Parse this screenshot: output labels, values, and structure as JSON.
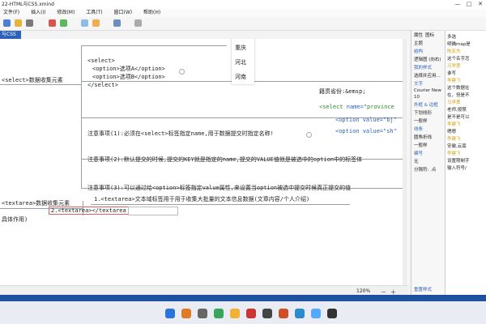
{
  "window": {
    "title": "22-HTML与CSS.xmind",
    "controls": [
      "—",
      "□",
      "✕"
    ]
  },
  "menu": {
    "items": [
      "文件(F)",
      "插入(I)",
      "修改(M)",
      "工具(T)",
      "窗口(W)",
      "帮助(H)"
    ]
  },
  "doc_tab": {
    "label": "与CSS"
  },
  "map": {
    "select_node": {
      "label": "<select>数据收集元素"
    },
    "select_code": {
      "lines": [
        "<select>",
        "  <option>选项A</option>",
        "  <option>选项B</option>",
        "</select>"
      ]
    },
    "dropdown": {
      "options": [
        "重庆",
        "河北",
        "河南"
      ]
    },
    "notes": [
      "注意事项(1):必须在<select>标签指定name,用于数据提交时指定名称!",
      "注意事项(2):默认提交的时候,提交的KEY就是指定的name,提交的VALUE值就是被选中的option中的标签体",
      "注意事项(3):可以通过给<option>标签指定value属性,来设置当option被选中提交时候真正提交的值"
    ],
    "code_snippet": {
      "line1": "籍贯省份:&emsp;",
      "line2_tag": "<select",
      "line2_attr": " name=",
      "line2_val": "\"province",
      "line3": "<option value=\"bj\"",
      "line4": "<option value=\"sh\""
    },
    "textarea_node": {
      "label": "<textarea>数据收集元素"
    },
    "textarea_sub1": "1.<textarea>文本域标签用于用于收集大批量的文本信息数据(文章内容/个人介绍)",
    "textarea_sub2": "2.<textarea></textarea",
    "left_bottom": "具体作用)"
  },
  "statusbar": {
    "zoom": "120%"
  },
  "sidebar": {
    "tabs": [
      "属性",
      "图标"
    ],
    "items": [
      "主题",
      "结构",
      "逻辑图 (向右)",
      "我的样式",
      "选择并应用...",
      "文字",
      "Courier New",
      "10",
      "外框 & 边框",
      "下划线形",
      "一般样",
      "线条",
      "圆角折线",
      "一般样",
      "编号",
      "无",
      "分隔符: .点"
    ],
    "footer": "重置样式"
  },
  "chat": {
    "lines": [
      {
        "name": "",
        "text": "多选"
      },
      {
        "name": "",
        "text": "明确map是"
      },
      {
        "name": "陈宏杰",
        "text": "这个名字怎"
      },
      {
        "name": "马学勇",
        "text": "谁写"
      },
      {
        "name": "李建飞",
        "text": "这个数据在"
      },
      {
        "name": "",
        "text": "在，但是不"
      },
      {
        "name": "马学勇",
        "text": "老师,按照"
      },
      {
        "name": "",
        "text": "是不是可以"
      },
      {
        "name": "李建飞",
        "text": "嗯嗯"
      },
      {
        "name": "李建飞",
        "text": "安徽,云南"
      },
      {
        "name": "李建飞",
        "text": "设置限制字"
      },
      {
        "name": "",
        "text": "输入符号/"
      }
    ]
  },
  "colors": {
    "accent": "#2e62b8",
    "taskbar": "#1b4f9c"
  }
}
